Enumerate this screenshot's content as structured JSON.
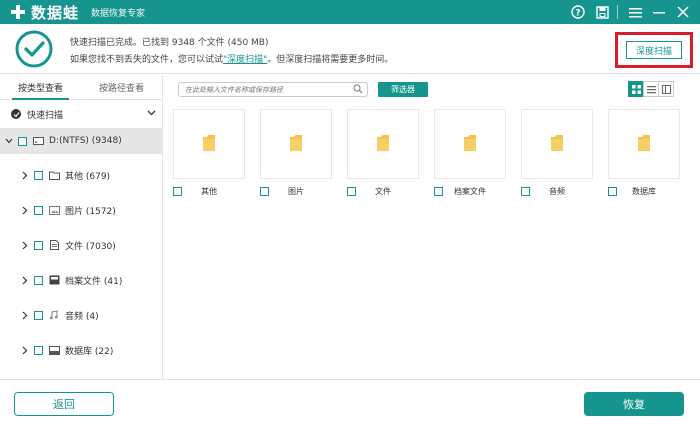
{
  "titlebar": {
    "app_name": "数据蛙",
    "subtitle": "数据恢复专家",
    "icons": [
      "help-icon",
      "save-icon",
      "menu-icon",
      "minimize-icon",
      "close-icon"
    ]
  },
  "info": {
    "line1": "快速扫描已完成。已找到 9348 个文件 (450 MB)",
    "line2_prefix": "如果您找不到丢失的文件，您可以试试",
    "line2_link": "\"深度扫描\"",
    "line2_suffix": "。但深度扫描将需要更多时间。",
    "deep_scan_label": "深度扫描"
  },
  "sidebar": {
    "tabs": [
      {
        "label": "按类型查看",
        "active": true
      },
      {
        "label": "按路径查看",
        "active": false
      }
    ],
    "quick_scan_label": "快速扫描",
    "drive_label": "D:(NTFS) (9348)",
    "categories": [
      {
        "label": "其他 (679)",
        "icon": "folder-icon"
      },
      {
        "label": "图片 (1572)",
        "icon": "image-icon"
      },
      {
        "label": "文件 (7030)",
        "icon": "document-icon"
      },
      {
        "label": "档案文件 (41)",
        "icon": "archive-icon"
      },
      {
        "label": "音频 (4)",
        "icon": "audio-icon"
      },
      {
        "label": "数据库 (22)",
        "icon": "database-icon"
      }
    ]
  },
  "main": {
    "search_placeholder": "在此处输入文件名称或保存路径",
    "filter_label": "筛选器",
    "view_modes": [
      "grid-view-icon",
      "list-view-icon",
      "detail-view-icon"
    ],
    "folders": [
      {
        "label": "其他"
      },
      {
        "label": "图片"
      },
      {
        "label": "文件"
      },
      {
        "label": "档案文件"
      },
      {
        "label": "音频"
      },
      {
        "label": "数据库"
      }
    ]
  },
  "footer": {
    "back_label": "返回",
    "recover_label": "恢复"
  },
  "colors": {
    "accent": "#16958f",
    "highlight": "#d71c2b",
    "folder": "#f5c24c"
  }
}
